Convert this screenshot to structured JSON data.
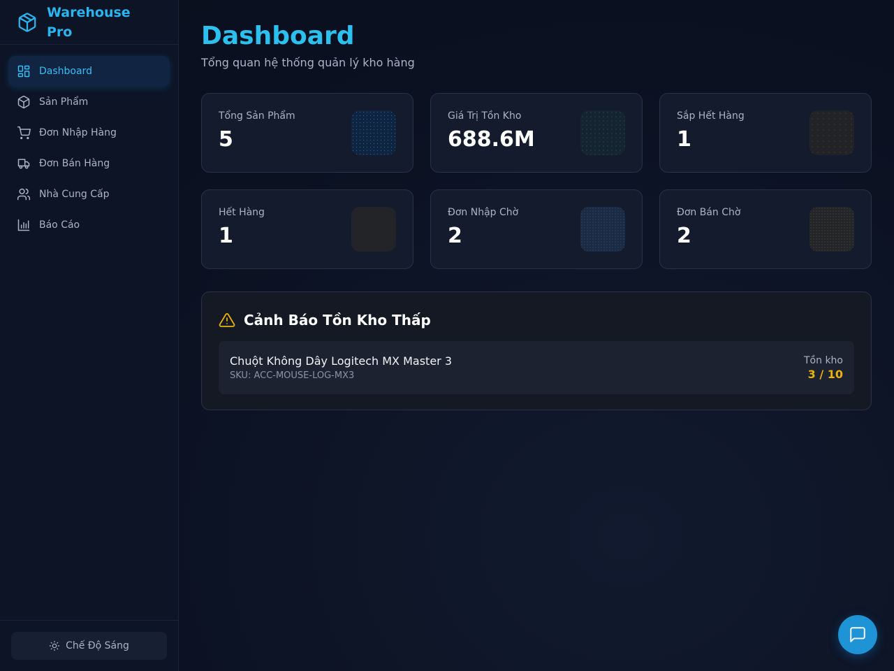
{
  "brand": {
    "name": "Warehouse Pro"
  },
  "sidebar": {
    "items": [
      {
        "label": "Dashboard",
        "icon": "layout-grid-icon",
        "active": true
      },
      {
        "label": "Sản Phẩm",
        "icon": "package-icon"
      },
      {
        "label": "Đơn Nhập Hàng",
        "icon": "shopping-cart-icon"
      },
      {
        "label": "Đơn Bán Hàng",
        "icon": "truck-icon"
      },
      {
        "label": "Nhà Cung Cấp",
        "icon": "users-icon"
      },
      {
        "label": "Báo Cáo",
        "icon": "bar-chart-icon"
      }
    ],
    "theme_toggle": "Chế Độ Sáng"
  },
  "page": {
    "title": "Dashboard",
    "subtitle": "Tổng quan hệ thống quản lý kho hàng"
  },
  "stats": [
    {
      "label": "Tổng Sản Phẩm",
      "value": "5"
    },
    {
      "label": "Giá Trị Tồn Kho",
      "value": "688.6M"
    },
    {
      "label": "Sắp Hết Hàng",
      "value": "1"
    },
    {
      "label": "Hết Hàng",
      "value": "1"
    },
    {
      "label": "Đơn Nhập Chờ",
      "value": "2"
    },
    {
      "label": "Đơn Bán Chờ",
      "value": "2"
    }
  ],
  "low_stock": {
    "title": "Cảnh Báo Tồn Kho Thấp",
    "items": [
      {
        "name": "Chuột Không Dây Logitech MX Master 3",
        "sku": "SKU: ACC-MOUSE-LOG-MX3",
        "stock_label": "Tồn kho",
        "stock_value": "3 / 10"
      }
    ]
  },
  "colors": {
    "accent": "#29b6f0",
    "warning": "#eab308",
    "background": "#0b1121"
  }
}
